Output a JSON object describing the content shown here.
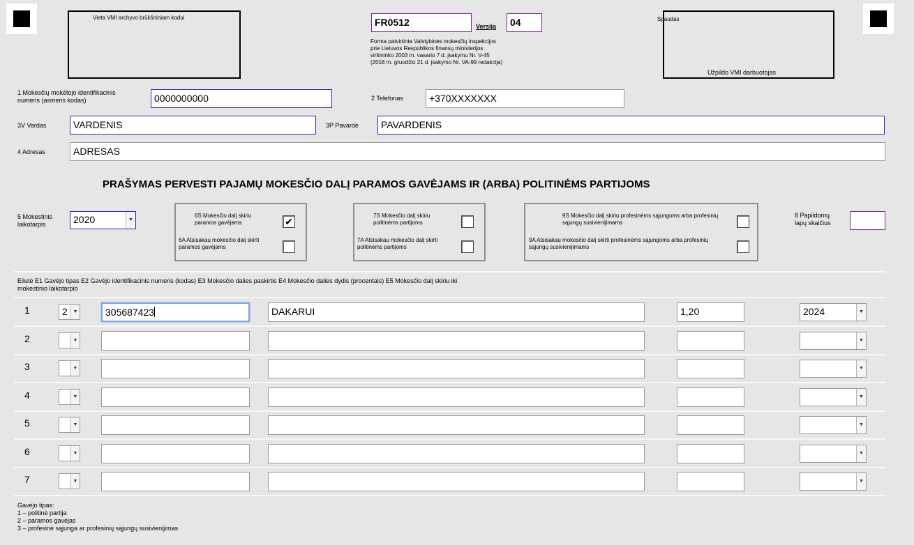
{
  "header": {
    "barcode_box_label": "Vieta VMI archyvo brūkšniniam kodui",
    "form_code": "FR0512",
    "version_label": "Versija",
    "version_value": "04",
    "approval_lines": [
      "Forma patvirtinta Valstybinės mokesčių inspekcijos",
      "prie Lietuvos Respublikos finansų ministerijos",
      "viršininko 2003 m. vasario 7 d. įsakymu Nr. V-45",
      "(2018 m. gruodžio 21 d. įsakymo Nr. VA-99 redakcija)"
    ],
    "stamp_label": "Spaudas",
    "stamp_footer": "Užpildo VMI darbuotojas"
  },
  "taxpayer": {
    "id_label_line1": "1 Mokesčių mokėtojo identifikacinis",
    "id_label_line2": "numeris (asmens kodas)",
    "id_value": "0000000000",
    "phone_label": "2 Telefonas",
    "phone_value": "+370XXXXXXX",
    "first_name_label": "3V Vardas",
    "first_name_value": "VARDENIS",
    "last_name_label": "3P Pavardė",
    "last_name_value": "PAVARDENIS",
    "address_label": "4 Adresas",
    "address_value": "ADRESAS"
  },
  "title": "PRAŠYMAS PERVESTI PAJAMŲ MOKESČIO DALĮ PARAMOS GAVĖJAMS IR (ARBA) POLITINĖMS PARTIJOMS",
  "period": {
    "label_line1": "5 Mokestinis",
    "label_line2": "laikotarpis",
    "value": "2020"
  },
  "options": {
    "o6s_line1": "6S Mokesčio dalį skiriu",
    "o6s_line2": "paramos gavėjams",
    "o6s_checked": "✔",
    "o6a_line1": "6A Atsisakau mokesčio dalį skirti",
    "o6a_line2": "paramos gavėjams",
    "o7s_line1": "7S Mokesčio dalį skiriu",
    "o7s_line2": "politinėms partijoms",
    "o7a_line1": "7A Atsisakau mokesčio dalį skirti",
    "o7a_line2": "politinėms partijoms",
    "o9s_line1": "9S Mokesčio dalį skiriu profesinėms sąjungoms arba profesinių",
    "o9s_line2": "sąjungų susivienijimams",
    "o9a_line1": "9A Atsisakau mokesčio dalį skirti profesinėms sąjungoms arba profesinių",
    "o9a_line2": "sąjungų susivienijimams"
  },
  "extra_pages": {
    "label_line1": "8 Papildomų",
    "label_line2": "lapų skaičius",
    "value": ""
  },
  "table": {
    "header_line1": "Eilutė E1 Gavėjo tipas E2 Gavėjo identifikacinis numeris (kodas) E3 Mokesčio dalies paskirtis E4 Mokesčio dalies dydis (procentais) E5 Mokesčio dalį skiriu iki",
    "header_line2": "mokestinio laikotarpio",
    "rows": [
      {
        "num": "1",
        "type": "2",
        "id": "305687423",
        "purpose": "DAKARUI",
        "percent": "1,20",
        "until": "2024"
      },
      {
        "num": "2",
        "type": "",
        "id": "",
        "purpose": "",
        "percent": "",
        "until": ""
      },
      {
        "num": "3",
        "type": "",
        "id": "",
        "purpose": "",
        "percent": "",
        "until": ""
      },
      {
        "num": "4",
        "type": "",
        "id": "",
        "purpose": "",
        "percent": "",
        "until": ""
      },
      {
        "num": "5",
        "type": "",
        "id": "",
        "purpose": "",
        "percent": "",
        "until": ""
      },
      {
        "num": "6",
        "type": "",
        "id": "",
        "purpose": "",
        "percent": "",
        "until": ""
      },
      {
        "num": "7",
        "type": "",
        "id": "",
        "purpose": "",
        "percent": "",
        "until": ""
      }
    ]
  },
  "legend": {
    "title": "Gavėjo tipas:",
    "items": [
      "1 – politinė partija",
      "2 – paramos gavėjas",
      "3 – profesinė sąjunga ar profesinių sąjungų susivienijimas"
    ]
  }
}
